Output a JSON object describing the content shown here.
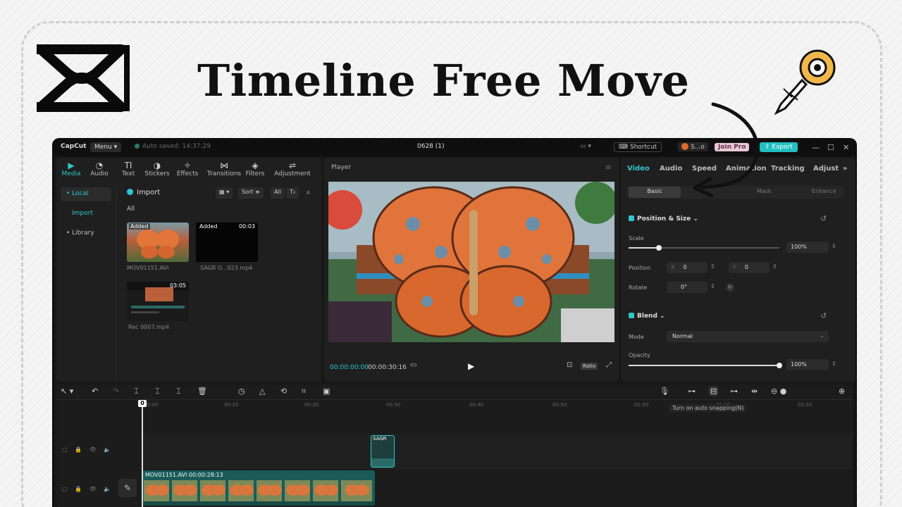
{
  "headline": "Timeline Free Move",
  "colors": {
    "accent": "#2fc7c9",
    "export": "#21bfc2",
    "clip": "#1b5b57",
    "app_bg": "#171717"
  },
  "titlebar": {
    "app_name": "CapCut",
    "menu_label": "Menu",
    "autosave_text": "Auto saved: 14:37:29",
    "project_title": "0628 (1)",
    "shortcut_label": "Shortcut",
    "user_label": "S...o",
    "join_pro_label": "Join Pro",
    "export_label": "Export"
  },
  "media_tabs": [
    {
      "label": "Media",
      "icon": "media-icon"
    },
    {
      "label": "Audio",
      "icon": "audio-icon"
    },
    {
      "label": "Text",
      "icon": "text-icon"
    },
    {
      "label": "Stickers",
      "icon": "stickers-icon"
    },
    {
      "label": "Effects",
      "icon": "effects-icon"
    },
    {
      "label": "Transitions",
      "icon": "transitions-icon"
    },
    {
      "label": "Filters",
      "icon": "filters-icon"
    },
    {
      "label": "Adjustment",
      "icon": "adjustment-icon"
    }
  ],
  "sidebar": {
    "local": "• Local",
    "import": "Import",
    "library": "• Library"
  },
  "media": {
    "import_label": "Import",
    "sort_label": "Sort",
    "all_filter": "All",
    "all_label": "All",
    "items": [
      {
        "badge": "Added",
        "name": "MOV01151.AVI",
        "duration": ""
      },
      {
        "badge": "Added",
        "name": "SAGR O...023.mp4",
        "duration": "00:03"
      },
      {
        "badge": "",
        "name": "Rec 0007.mp4",
        "duration": "03:05"
      }
    ]
  },
  "player": {
    "title": "Player",
    "timecode_current": "00:00:00:00",
    "timecode_total": "00:00:30:16",
    "ratio_label": "Ratio"
  },
  "props": {
    "tabs": [
      "Video",
      "Audio",
      "Speed",
      "Animation",
      "Tracking",
      "Adjust"
    ],
    "subtabs": [
      "Basic",
      "Mask",
      "Enhance"
    ],
    "position_size_title": "Position & Size",
    "scale_label": "Scale",
    "scale_value": "100%",
    "scale_fraction": 0.2,
    "position_label": "Position",
    "x_prefix": "X",
    "x_value": "0",
    "y_prefix": "Y",
    "y_value": "0",
    "rotate_label": "Rotate",
    "rotate_value": "0°",
    "blend_title": "Blend",
    "mode_label": "Mode",
    "mode_value": "Normal",
    "opacity_label": "Opacity",
    "opacity_value": "100%",
    "opacity_fraction": 1.0
  },
  "timeline": {
    "tooltip": "Turn on auto snapping(N)",
    "ruler_labels": [
      "00:00",
      "00:10",
      "00:20",
      "00:30",
      "00:40",
      "00:50",
      "01:00",
      "01:10",
      "01:20"
    ],
    "playhead_label": "0",
    "small_clip_label": "SAGR",
    "main_clip_name": "MOV01151.AVI",
    "main_clip_duration": "00:00:28:13"
  }
}
